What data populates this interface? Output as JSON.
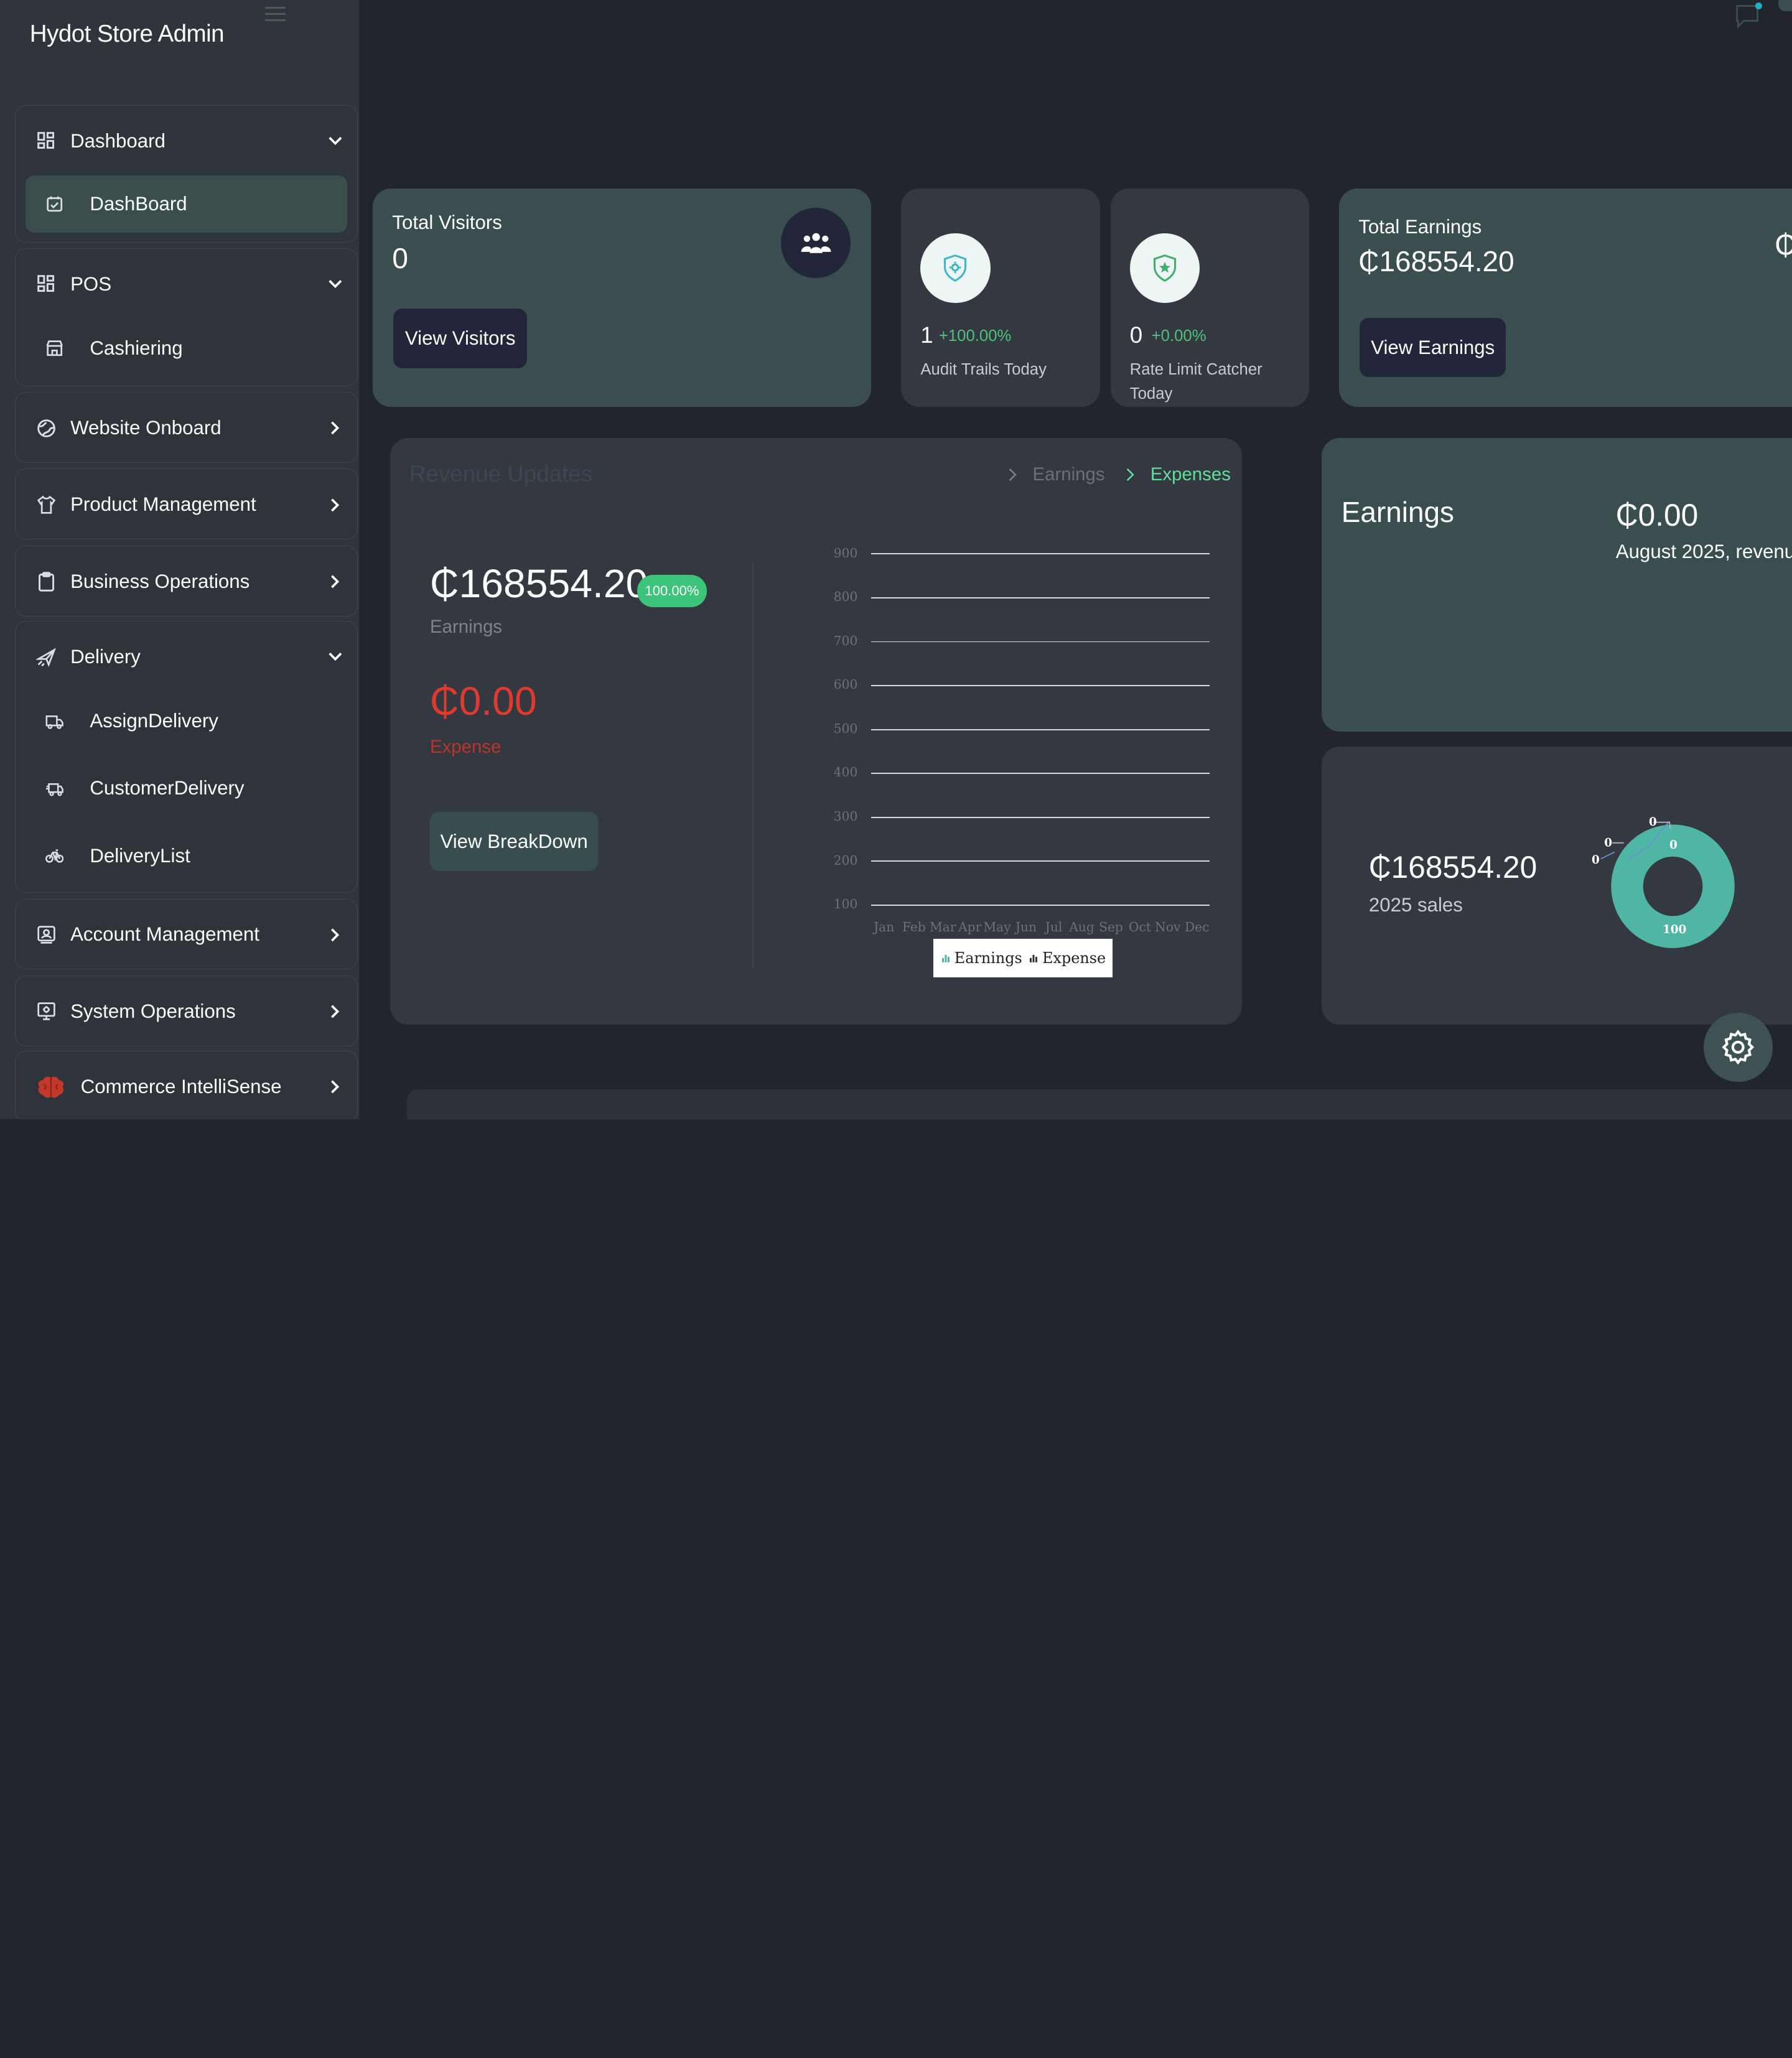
{
  "app": {
    "title": "Hydot Store Admin"
  },
  "sidebar": {
    "dashboard": {
      "label": "Dashboard",
      "sub": "DashBoard"
    },
    "pos": {
      "label": "POS",
      "sub": "Cashiering"
    },
    "website": {
      "label": "Website Onboard"
    },
    "product": {
      "label": "Product Management"
    },
    "business": {
      "label": "Business Operations"
    },
    "delivery": {
      "label": "Delivery",
      "subs": [
        "AssignDelivery",
        "CustomerDelivery",
        "DeliveryList"
      ]
    },
    "account": {
      "label": "Account Management"
    },
    "system": {
      "label": "System Operations"
    },
    "commerce": {
      "label": "Commerce IntelliSense"
    }
  },
  "visitors": {
    "title": "Total Visitors",
    "value": "0",
    "button": "View Visitors"
  },
  "audit": {
    "value": "1",
    "percent": "+100.00%",
    "label": "Audit Trails Today"
  },
  "rate": {
    "value": "0",
    "percent": "+0.00%",
    "label": "Rate Limit Catcher Today"
  },
  "earnings_card": {
    "title": "Total Earnings",
    "value": "₵168554.20",
    "button": "View Earnings",
    "edge": "₵"
  },
  "revenue": {
    "title": "Revenue Updates",
    "tab1": "Earnings",
    "tab2": "Expenses",
    "earn_value": "₵168554.20",
    "earn_badge": "100.00%",
    "earn_label": "Earnings",
    "exp_value": "₵0.00",
    "exp_label": "Expense",
    "button": "View BreakDown"
  },
  "chart_data": {
    "type": "bar",
    "categories": [
      "Jan",
      "Feb",
      "Mar",
      "Apr",
      "May",
      "Jun",
      "Jul",
      "Aug",
      "Sep",
      "Oct",
      "Nov",
      "Dec"
    ],
    "yticks": [
      "900",
      "800",
      "700",
      "600",
      "500",
      "400",
      "300",
      "200",
      "100"
    ],
    "series": [
      {
        "name": "Earnings",
        "values": [
          0,
          0,
          0,
          0,
          0,
          0,
          0,
          0,
          0,
          0,
          0,
          0
        ]
      },
      {
        "name": "Expense",
        "values": [
          0,
          0,
          0,
          0,
          0,
          0,
          0,
          0,
          0,
          0,
          0,
          0
        ]
      }
    ],
    "ylim": [
      100,
      900
    ],
    "legend": "bottom",
    "grid": true
  },
  "earnings_panel": {
    "title": "Earnings",
    "value": "₵0.00",
    "subtitle": "August 2025, revenu"
  },
  "sales": {
    "value": "₵168554.20",
    "label": "2025 sales",
    "donut_labels": [
      "0",
      "0",
      "0",
      "0"
    ],
    "donut_main": "100",
    "donut_color": "#4fb6a6"
  },
  "colors": {
    "accent": "#5ee09a",
    "teal_card": "#3a4d4f",
    "expense": "#e03a2f"
  }
}
